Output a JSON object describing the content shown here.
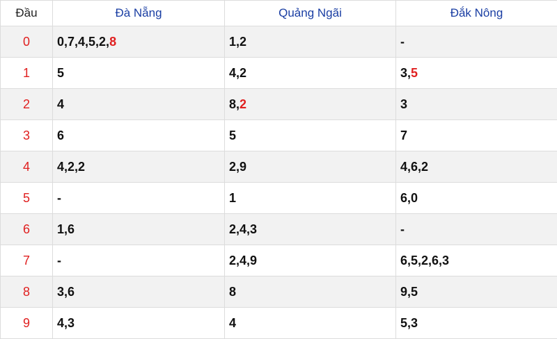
{
  "headers": [
    "Đầu",
    "Đà Nẵng",
    "Quảng Ngãi",
    "Đắk Nông"
  ],
  "highlight_color": "#e02020",
  "header_color": "#1a3ea3",
  "rows": [
    {
      "dau": "0",
      "cells": [
        {
          "pre": "0,7,4,5,2,",
          "hl": "8"
        },
        {
          "pre": "1,2",
          "hl": ""
        },
        {
          "pre": "-",
          "hl": ""
        }
      ]
    },
    {
      "dau": "1",
      "cells": [
        {
          "pre": "5",
          "hl": ""
        },
        {
          "pre": "4,2",
          "hl": ""
        },
        {
          "pre": "3,",
          "hl": "5"
        }
      ]
    },
    {
      "dau": "2",
      "cells": [
        {
          "pre": "4",
          "hl": ""
        },
        {
          "pre": "8,",
          "hl": "2"
        },
        {
          "pre": "3",
          "hl": ""
        }
      ]
    },
    {
      "dau": "3",
      "cells": [
        {
          "pre": "6",
          "hl": ""
        },
        {
          "pre": "5",
          "hl": ""
        },
        {
          "pre": "7",
          "hl": ""
        }
      ]
    },
    {
      "dau": "4",
      "cells": [
        {
          "pre": "4,2,2",
          "hl": ""
        },
        {
          "pre": "2,9",
          "hl": ""
        },
        {
          "pre": "4,6,2",
          "hl": ""
        }
      ]
    },
    {
      "dau": "5",
      "cells": [
        {
          "pre": "-",
          "hl": ""
        },
        {
          "pre": "1",
          "hl": ""
        },
        {
          "pre": "6,0",
          "hl": ""
        }
      ]
    },
    {
      "dau": "6",
      "cells": [
        {
          "pre": "1,6",
          "hl": ""
        },
        {
          "pre": "2,4,3",
          "hl": ""
        },
        {
          "pre": "-",
          "hl": ""
        }
      ]
    },
    {
      "dau": "7",
      "cells": [
        {
          "pre": "-",
          "hl": ""
        },
        {
          "pre": "2,4,9",
          "hl": ""
        },
        {
          "pre": "6,5,2,6,3",
          "hl": ""
        }
      ]
    },
    {
      "dau": "8",
      "cells": [
        {
          "pre": "3,6",
          "hl": ""
        },
        {
          "pre": "8",
          "hl": ""
        },
        {
          "pre": "9,5",
          "hl": ""
        }
      ]
    },
    {
      "dau": "9",
      "cells": [
        {
          "pre": "4,3",
          "hl": ""
        },
        {
          "pre": "4",
          "hl": ""
        },
        {
          "pre": "5,3",
          "hl": ""
        }
      ]
    }
  ]
}
